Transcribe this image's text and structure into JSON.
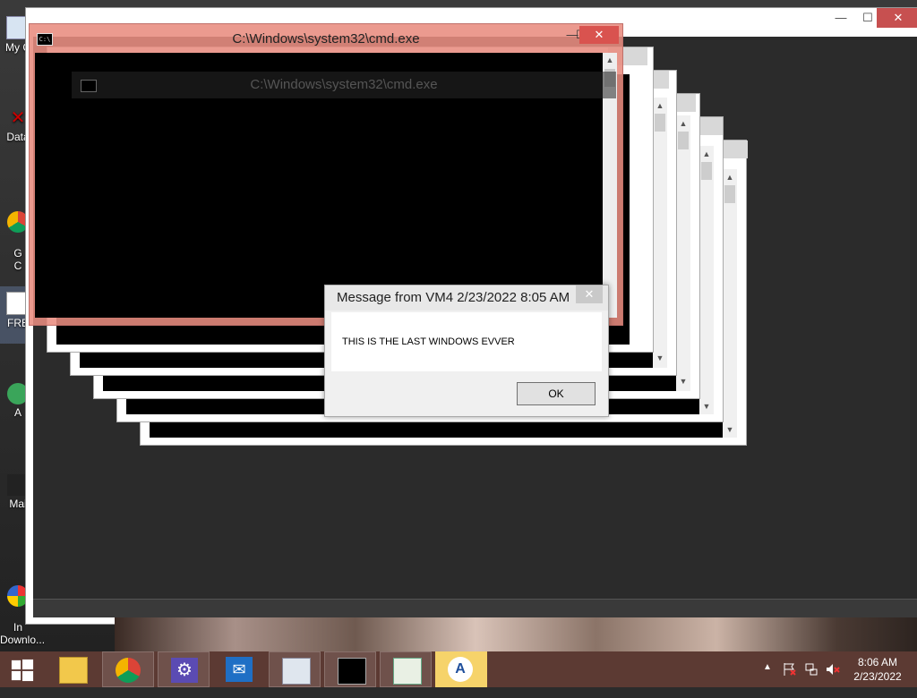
{
  "desktop": {
    "icons": [
      {
        "label": "My C"
      },
      {
        "label": "Data"
      },
      {
        "label": "G\nC"
      },
      {
        "label": "FRE"
      },
      {
        "label": "A"
      },
      {
        "label": "Mai"
      },
      {
        "label": "In\nDownlo..."
      }
    ]
  },
  "background_window": {
    "minimize": "—",
    "maximize": "☐",
    "close": "✕"
  },
  "front_cmd": {
    "title": "C:\\Windows\\system32\\cmd.exe",
    "icon_text": "C:\\",
    "minimize": "—",
    "maximize": "☐",
    "close": "✕",
    "scroll_up": "▲"
  },
  "cmd2": {
    "title": "C:\\Windows\\system32\\cmd.exe"
  },
  "message_box": {
    "title": "Message from VM4 2/23/2022 8:05 AM",
    "body": "THIS IS THE LAST WINDOWS EVVER",
    "ok_label": "OK",
    "close": "✕"
  },
  "taskbar": {
    "items": [
      "start",
      "file-explorer",
      "chrome",
      "settings",
      "mail",
      "performance-monitor",
      "cmd",
      "notepad",
      "remote-app"
    ],
    "tray": {
      "up_arrow": "▲",
      "clock_time": "8:06 AM",
      "clock_date": "2/23/2022"
    }
  }
}
